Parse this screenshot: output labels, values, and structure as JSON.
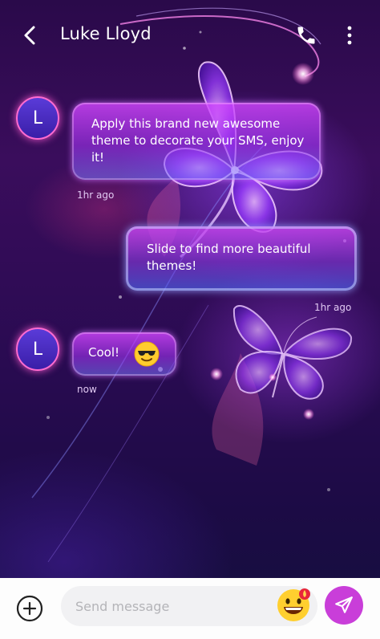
{
  "header": {
    "contact_name": "Luke Lloyd",
    "back_icon": "chevron-left-icon",
    "call_icon": "phone-icon",
    "more_icon": "more-vertical-icon"
  },
  "messages": [
    {
      "direction": "incoming",
      "avatar_letter": "L",
      "text": "Apply this brand new awesome theme to decorate your SMS, enjoy it!",
      "time": "1hr ago"
    },
    {
      "direction": "outgoing",
      "text": "Slide to find more beautiful themes!",
      "time": "1hr ago"
    },
    {
      "direction": "incoming",
      "avatar_letter": "L",
      "text": "Cool!",
      "emoji": "sunglasses-emoji",
      "time": "now"
    }
  ],
  "composer": {
    "placeholder": "Send message",
    "value": "",
    "add_icon": "plus-circle-icon",
    "emoji_icon": "grinning-emoji-icon",
    "send_icon": "send-icon"
  },
  "colors": {
    "accent": "#c93ed9",
    "avatar_ring": "#ff6bd0",
    "background_top": "#2a0a4a",
    "background_bottom": "#14103e"
  }
}
